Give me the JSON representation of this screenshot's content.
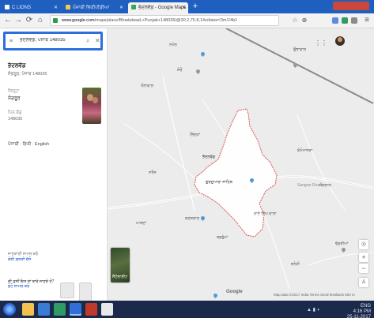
{
  "browser": {
    "tabs": [
      {
        "label": "C LIONS",
        "active": false
      },
      {
        "label": "ਪੰਜਾਬੀ ਵਿਕੀਪੀਡੀਆ",
        "active": false
      },
      {
        "label": "ਭੱਦਲਵੱਡ - Google Maps",
        "active": true
      }
    ],
    "new_tab": "+",
    "url_host": "www.google.com",
    "url_path": "/maps/place/Bhadalwad,+Punjab+148035/@30.2,75.8,14z/data=!3m1!4b1",
    "omnibox_icons": [
      "star-icon",
      "zoom-icon"
    ],
    "toolbar_icons": {
      "back": "←",
      "forward": "→",
      "reload": "⟳",
      "home": "⌂"
    }
  },
  "panel": {
    "search_query": "ਭੱਦਲਵੱਡ, ਪੰਜਾਬ 148035",
    "place_title": "ਭੱਦਲਵੱਡ",
    "place_subtitle": "ਸੰਗਰੂਰ, ਪੰਜਾਬ 148035",
    "rows": [
      {
        "label": "ਜ਼ਿਲ੍ਹਾ",
        "value": "ਸੰਗਰੂਰ"
      },
      {
        "label": "ਪਿਨ ਕੋਡ",
        "value": "148035"
      }
    ],
    "languages": "ਪੰਜਾਬੀ · हिन्दी · English",
    "footnote_text": "ਜਾਣਕਾਰੀ ਸ਼ਾਮਲ ਕਰੋ",
    "footnote_link": "ਕੋਈ ਗ਼ਲਤੀ ਦੱਸੋ",
    "footer_prompt": "ਕੀ ਤੁਸੀਂ ਇਸ ਥਾਂ ਬਾਰੇ ਜਾਣਦੇ ਹੋ?",
    "footer_link": "ਫ਼ੋਟੋ ਸ਼ਾਮਲ ਕਰੋ"
  },
  "map": {
    "labels": [
      {
        "id": "l1",
        "text": "ਨਮੋਲ"
      },
      {
        "id": "l2",
        "text": "ਸ਼ੇਰੋਂ"
      },
      {
        "id": "l3",
        "text": "ਤੋਲਾਵਾਲ"
      },
      {
        "id": "l4",
        "text": "ਭੱਦਲਵੱਡ"
      },
      {
        "id": "l5",
        "text": "ਉਭਾਵਾਲ"
      },
      {
        "id": "l6",
        "text": "ਕੰਮੋਮਾਜਰਾ"
      },
      {
        "id": "l7",
        "text": "ਗੁਰਦੁਆਰਾ ਸਾਹਿਬ"
      },
      {
        "id": "l8",
        "text": "ਲਿੱਦੜਾਂ"
      },
      {
        "id": "l9",
        "text": "ਰਾਏ ਸਿੰਘ ਵਾਲਾ"
      },
      {
        "id": "l10",
        "text": "ਸਤੌਜ"
      },
      {
        "id": "l11",
        "text": "ਘਾਬਦਾਂ"
      },
      {
        "id": "l12",
        "text": "ਕਣਕਵਾਲ"
      },
      {
        "id": "l13",
        "text": "ਬਡਰੁੱਖਾਂ"
      },
      {
        "id": "l14",
        "text": "ਮੰਗਵਾਲ"
      },
      {
        "id": "l15",
        "text": "ਢੱਡਰੀਆਂ"
      },
      {
        "id": "l16",
        "text": "ਝਨੇੜੀ"
      }
    ],
    "road_label": "Sangrur Road",
    "satellite_label": "ਸੈਟੇਲਾਈਟ",
    "google_mark": "Google",
    "attribution": "Map data ©2017  India  Terms  Send feedback  500 m"
  },
  "taskbar": {
    "tray_time": "4:16 PM",
    "tray_date": "25-11-2017",
    "tray_lang": "ENG"
  },
  "colors": {
    "highlight_fill": "#ffffff",
    "highlight_border": "#d9534f",
    "search_border": "#2d6fe0",
    "map_bg": "#ececec",
    "tabstrip": "#1f5fbf"
  }
}
